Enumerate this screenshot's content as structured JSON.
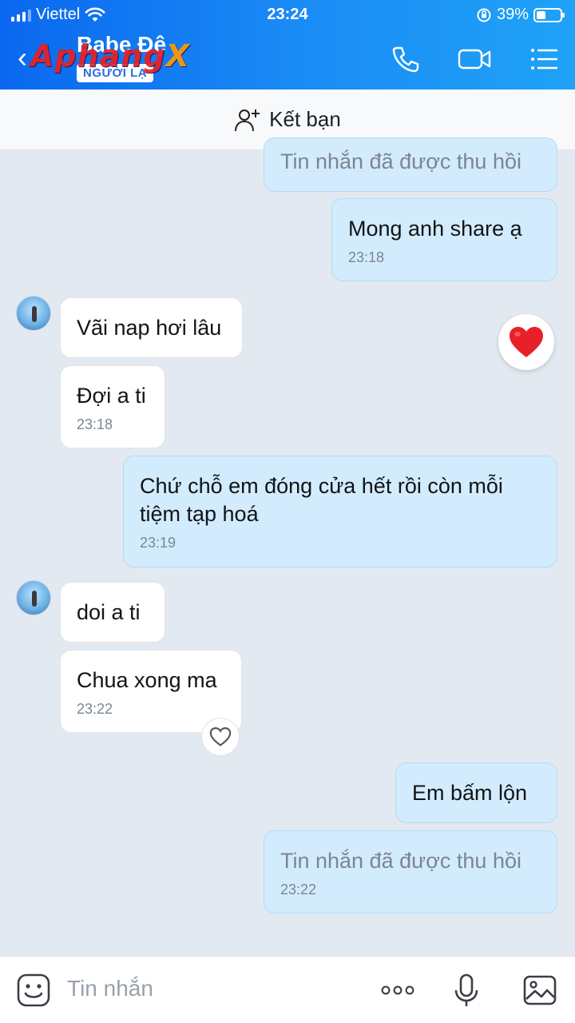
{
  "status_bar": {
    "carrier": "Viettel",
    "time": "23:24",
    "battery": "39%",
    "battery_level": 0.39
  },
  "header": {
    "contact_name": "Babe Đệ",
    "stranger_badge": "NGƯỜI LẠ",
    "watermark_a": "Aphang",
    "watermark_b": "X"
  },
  "add_friend": {
    "label": "Kết bạn"
  },
  "messages": [
    {
      "side": "out",
      "text": "Tin nhắn đã được thu hồi",
      "time": "",
      "recalled": true
    },
    {
      "side": "out",
      "text": "Mong anh share ạ",
      "time": "23:18"
    },
    {
      "side": "in",
      "text": "Vãi nap hơi lâu",
      "time": ""
    },
    {
      "side": "in",
      "text": "Đợi a ti",
      "time": "23:18"
    },
    {
      "side": "out",
      "text": "Chứ chỗ em đóng cửa hết rồi còn mỗi tiệm tạp hoá",
      "time": "23:19"
    },
    {
      "side": "in",
      "text": "doi a ti",
      "time": ""
    },
    {
      "side": "in",
      "text": "Chua xong ma",
      "time": "23:22"
    },
    {
      "side": "out",
      "text": "Em bấm lộn",
      "time": ""
    },
    {
      "side": "out",
      "text": "Tin nhắn đã được thu hồi",
      "time": "23:22",
      "recalled": true
    }
  ],
  "composer": {
    "placeholder": "Tin nhắn"
  },
  "colors": {
    "header_start": "#0a68f0",
    "header_end": "#1fa2f7",
    "bubble_out": "#d2ecfd",
    "bubble_in": "#ffffff",
    "heart": "#e8202a"
  }
}
